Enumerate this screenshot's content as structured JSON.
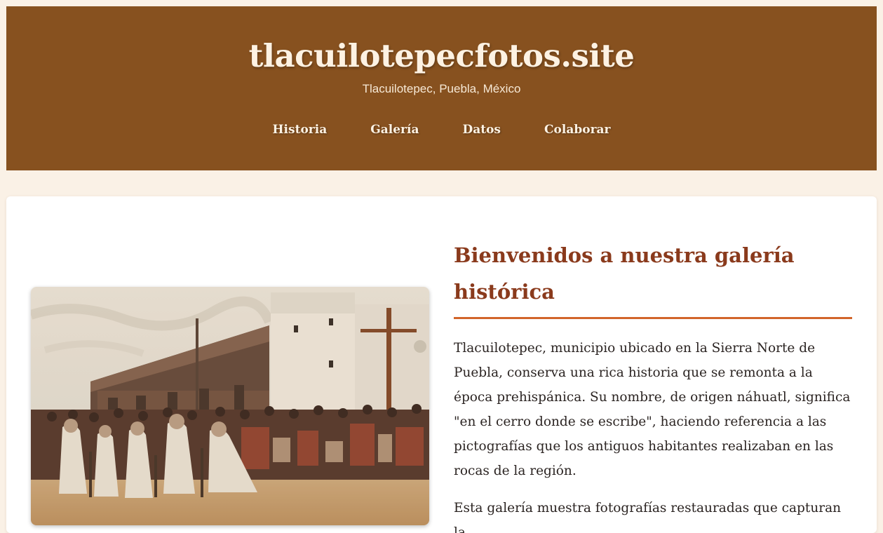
{
  "header": {
    "title": "tlacuilotepecfotos.site",
    "subtitle": "Tlacuilotepec, Puebla, México",
    "nav": [
      "Historia",
      "Galería",
      "Datos",
      "Colaborar"
    ]
  },
  "main": {
    "photo_icon": "historic-photo",
    "heading": "Bienvenidos a nuestra galería histórica",
    "paragraph1": "Tlacuilotepec, municipio ubicado en la Sierra Norte de Puebla, conserva una rica historia que se remonta a la época prehispánica. Su nombre, de origen náhuatl, significa \"en el cerro donde se escribe\", haciendo referencia a las pictografías que los antiguos habitantes realizaban en las rocas de la región.",
    "paragraph2": "Esta galería muestra fotografías restauradas que capturan la"
  },
  "colors": {
    "header_bg": "#87511f",
    "page_bg": "#faf1e6",
    "heading": "#8a3a1c",
    "accent_rule": "#d2652a"
  }
}
